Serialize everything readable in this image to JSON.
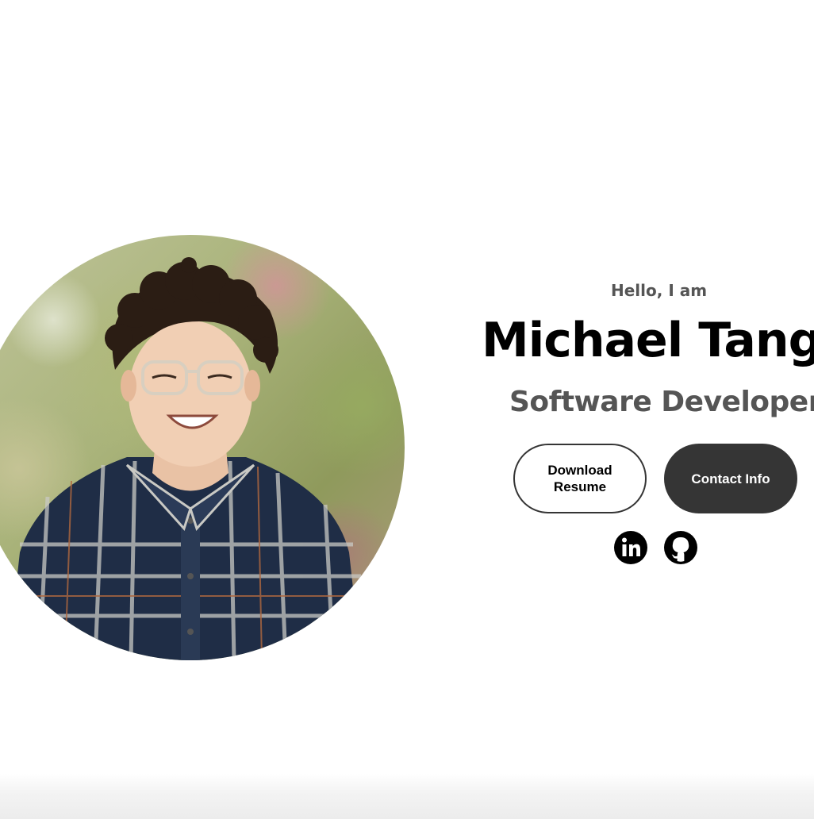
{
  "hero": {
    "greeting": "Hello, I am",
    "name": "Michael Tang",
    "title": "Software Developer",
    "buttons": {
      "resume_label": "Download Resume",
      "contact_label": "Contact Info"
    },
    "socials": [
      {
        "icon": "linkedin-icon"
      },
      {
        "icon": "github-icon"
      }
    ]
  },
  "colors": {
    "dark_button": "#353535",
    "heading": "#000000",
    "subtext": "#555555"
  }
}
